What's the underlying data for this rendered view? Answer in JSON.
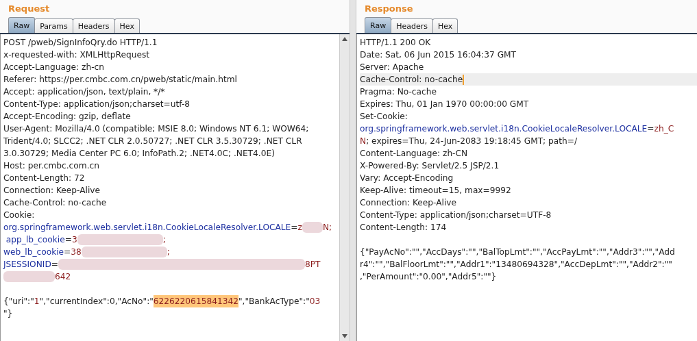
{
  "panels": [
    {
      "title": "Request",
      "scrollbar": true,
      "tabs": [
        {
          "label": "Raw",
          "selected": true
        },
        {
          "label": "Params",
          "selected": false
        },
        {
          "label": "Headers",
          "selected": false
        },
        {
          "label": "Hex",
          "selected": false
        }
      ],
      "lines": [
        {
          "current": false,
          "segments": [
            {
              "kind": "plain",
              "text": "POST /pweb/SignInfoQry.do HTTP/1.1"
            }
          ]
        },
        {
          "current": false,
          "segments": [
            {
              "kind": "plain",
              "text": "x-requested-with: XMLHttpRequest"
            }
          ]
        },
        {
          "current": false,
          "segments": [
            {
              "kind": "plain",
              "text": "Accept-Language: zh-cn"
            }
          ]
        },
        {
          "current": false,
          "segments": [
            {
              "kind": "plain",
              "text": "Referer: https://per.cmbc.com.cn/pweb/static/main.html"
            }
          ]
        },
        {
          "current": false,
          "segments": [
            {
              "kind": "plain",
              "text": "Accept: application/json, text/plain, */*"
            }
          ]
        },
        {
          "current": false,
          "segments": [
            {
              "kind": "plain",
              "text": "Content-Type: application/json;charset=utf-8"
            }
          ]
        },
        {
          "current": false,
          "segments": [
            {
              "kind": "plain",
              "text": "Accept-Encoding: gzip, deflate"
            }
          ]
        },
        {
          "current": false,
          "segments": [
            {
              "kind": "plain",
              "text": "User-Agent: Mozilla/4.0 (compatible; MSIE 8.0; Windows NT 6.1; WOW64;"
            }
          ]
        },
        {
          "current": false,
          "segments": [
            {
              "kind": "plain",
              "text": "Trident/4.0; SLCC2; .NET CLR 2.0.50727; .NET CLR 3.5.30729; .NET CLR"
            }
          ]
        },
        {
          "current": false,
          "segments": [
            {
              "kind": "plain",
              "text": "3.0.30729; Media Center PC 6.0; InfoPath.2; .NET4.0C; .NET4.0E)"
            }
          ]
        },
        {
          "current": false,
          "segments": [
            {
              "kind": "plain",
              "text": "Host: per.cmbc.com.cn"
            }
          ]
        },
        {
          "current": false,
          "segments": [
            {
              "kind": "plain",
              "text": "Content-Length: 72"
            }
          ]
        },
        {
          "current": false,
          "segments": [
            {
              "kind": "plain",
              "text": "Connection: Keep-Alive"
            }
          ]
        },
        {
          "current": false,
          "segments": [
            {
              "kind": "plain",
              "text": "Cache-Control: no-cache"
            }
          ]
        },
        {
          "current": false,
          "segments": [
            {
              "kind": "plain",
              "text": "Cookie:"
            }
          ]
        },
        {
          "current": false,
          "segments": [
            {
              "kind": "name",
              "text": "org.springframework.web.servlet.i18n.CookieLocaleResolver.LOCALE"
            },
            {
              "kind": "plain",
              "text": "="
            },
            {
              "kind": "value",
              "text": "z"
            },
            {
              "kind": "blur_short"
            },
            {
              "kind": "value",
              "text": "N;"
            }
          ]
        },
        {
          "current": false,
          "segments": [
            {
              "kind": "name",
              "text": " app_lb_cookie"
            },
            {
              "kind": "plain",
              "text": "="
            },
            {
              "kind": "value",
              "text": "3"
            },
            {
              "kind": "blur_long"
            },
            {
              "kind": "value",
              "text": ";"
            }
          ]
        },
        {
          "current": false,
          "segments": [
            {
              "kind": "name",
              "text": "web_lb_cookie"
            },
            {
              "kind": "plain",
              "text": "="
            },
            {
              "kind": "value",
              "text": "38"
            },
            {
              "kind": "blur_long"
            },
            {
              "kind": "value",
              "text": ";"
            }
          ]
        },
        {
          "current": false,
          "segments": [
            {
              "kind": "name",
              "text": "JSESSIONID"
            },
            {
              "kind": "plain",
              "text": "="
            },
            {
              "kind": "blur_wide"
            },
            {
              "kind": "value",
              "text": "8PT"
            }
          ]
        },
        {
          "current": false,
          "segments": [
            {
              "kind": "blur_medium"
            },
            {
              "kind": "value",
              "text": "642"
            }
          ]
        },
        {
          "current": false
        },
        {
          "current": false,
          "segments": [
            {
              "kind": "plain",
              "text": "{\"uri\":\""
            },
            {
              "kind": "value",
              "text": "1"
            },
            {
              "kind": "plain",
              "text": "\",\"currentIndex\":0,\"AcNo\":\""
            },
            {
              "kind": "highlight",
              "text": "6226220615841342"
            },
            {
              "kind": "plain",
              "text": "\",\"BankAcType\":\""
            },
            {
              "kind": "value",
              "text": "03"
            }
          ]
        },
        {
          "current": false,
          "segments": [
            {
              "kind": "plain",
              "text": "\"}"
            }
          ]
        }
      ]
    },
    {
      "title": "Response",
      "scrollbar": false,
      "tabs": [
        {
          "label": "Raw",
          "selected": true
        },
        {
          "label": "Headers",
          "selected": false
        },
        {
          "label": "Hex",
          "selected": false
        }
      ],
      "lines": [
        {
          "current": false,
          "segments": [
            {
              "kind": "plain",
              "text": "HTTP/1.1 200 OK"
            }
          ]
        },
        {
          "current": false,
          "segments": [
            {
              "kind": "plain",
              "text": "Date: Sat, 06 Jun 2015 16:04:37 GMT"
            }
          ]
        },
        {
          "current": false,
          "segments": [
            {
              "kind": "plain",
              "text": "Server: Apache"
            }
          ]
        },
        {
          "current": true,
          "segments": [
            {
              "kind": "plain",
              "text": "Cache-Control: no-cache"
            }
          ]
        },
        {
          "current": false,
          "segments": [
            {
              "kind": "plain",
              "text": "Pragma: No-cache"
            }
          ]
        },
        {
          "current": false,
          "segments": [
            {
              "kind": "plain",
              "text": "Expires: Thu, 01 Jan 1970 00:00:00 GMT"
            }
          ]
        },
        {
          "current": false,
          "segments": [
            {
              "kind": "plain",
              "text": "Set-Cookie:"
            }
          ]
        },
        {
          "current": false,
          "segments": [
            {
              "kind": "name",
              "text": "org.springframework.web.servlet.i18n.CookieLocaleResolver.LOCALE"
            },
            {
              "kind": "plain",
              "text": "="
            },
            {
              "kind": "value",
              "text": "zh_C"
            }
          ]
        },
        {
          "current": false,
          "segments": [
            {
              "kind": "value",
              "text": "N"
            },
            {
              "kind": "plain",
              "text": "; expires=Thu, 24-Jun-2083 19:18:45 GMT; path=/"
            }
          ]
        },
        {
          "current": false,
          "segments": [
            {
              "kind": "plain",
              "text": "Content-Language: zh-CN"
            }
          ]
        },
        {
          "current": false,
          "segments": [
            {
              "kind": "plain",
              "text": "X-Powered-By: Servlet/2.5 JSP/2.1"
            }
          ]
        },
        {
          "current": false,
          "segments": [
            {
              "kind": "plain",
              "text": "Vary: Accept-Encoding"
            }
          ]
        },
        {
          "current": false,
          "segments": [
            {
              "kind": "plain",
              "text": "Keep-Alive: timeout=15, max=9992"
            }
          ]
        },
        {
          "current": false,
          "segments": [
            {
              "kind": "plain",
              "text": "Connection: Keep-Alive"
            }
          ]
        },
        {
          "current": false,
          "segments": [
            {
              "kind": "plain",
              "text": "Content-Type: application/json;charset=UTF-8"
            }
          ]
        },
        {
          "current": false,
          "segments": [
            {
              "kind": "plain",
              "text": "Content-Length: 174"
            }
          ]
        },
        {
          "current": false
        },
        {
          "current": false,
          "segments": [
            {
              "kind": "plain",
              "text": "{\"PayAcNo\":\"\",\"AccDays\":\"\",\"BalTopLmt\":\"\",\"AccPayLmt\":\"\",\"Addr3\":\"\",\"Add"
            }
          ]
        },
        {
          "current": false,
          "segments": [
            {
              "kind": "plain",
              "text": "r4\":\"\",\"BalFloorLmt\":\"\",\"Addr1\":\"13480694328\",\"AccDepLmt\":\"\",\"Addr2\":\"\""
            }
          ]
        },
        {
          "current": false,
          "segments": [
            {
              "kind": "plain",
              "text": ",\"PerAmount\":\"0.00\",\"Addr5\":\"\"}"
            }
          ]
        }
      ]
    }
  ]
}
